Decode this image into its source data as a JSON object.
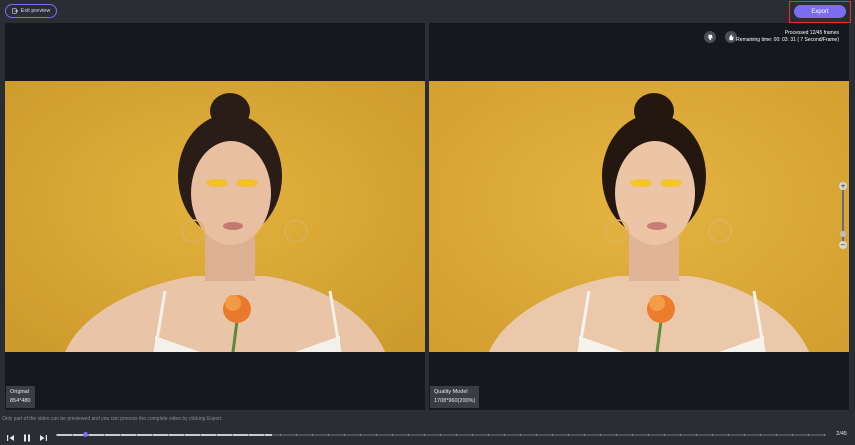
{
  "header": {
    "exit_label": "Exit preview",
    "export_label": "Export"
  },
  "left_pane": {
    "label": "Original",
    "resolution": "854*480"
  },
  "right_pane": {
    "label": "Quality Model",
    "resolution": "1708*960(200%)",
    "processed": "Processed 12/45 frames",
    "remaining": "Remaining time: 00: 03: 31 ( 7 Second/Frame)"
  },
  "zoom": {
    "plus": "+",
    "minus": "−"
  },
  "footer": {
    "notice": "Only part of the video can be previewed and you can process the complete video by clicking Export.",
    "frame_counter": "2/45",
    "progress": 0.28,
    "playhead": 0.02
  },
  "colors": {
    "accent": "#7b6cf0",
    "highlight": "#e8322e",
    "background": "#2a2d34",
    "photo_bg": "#d9a634"
  }
}
